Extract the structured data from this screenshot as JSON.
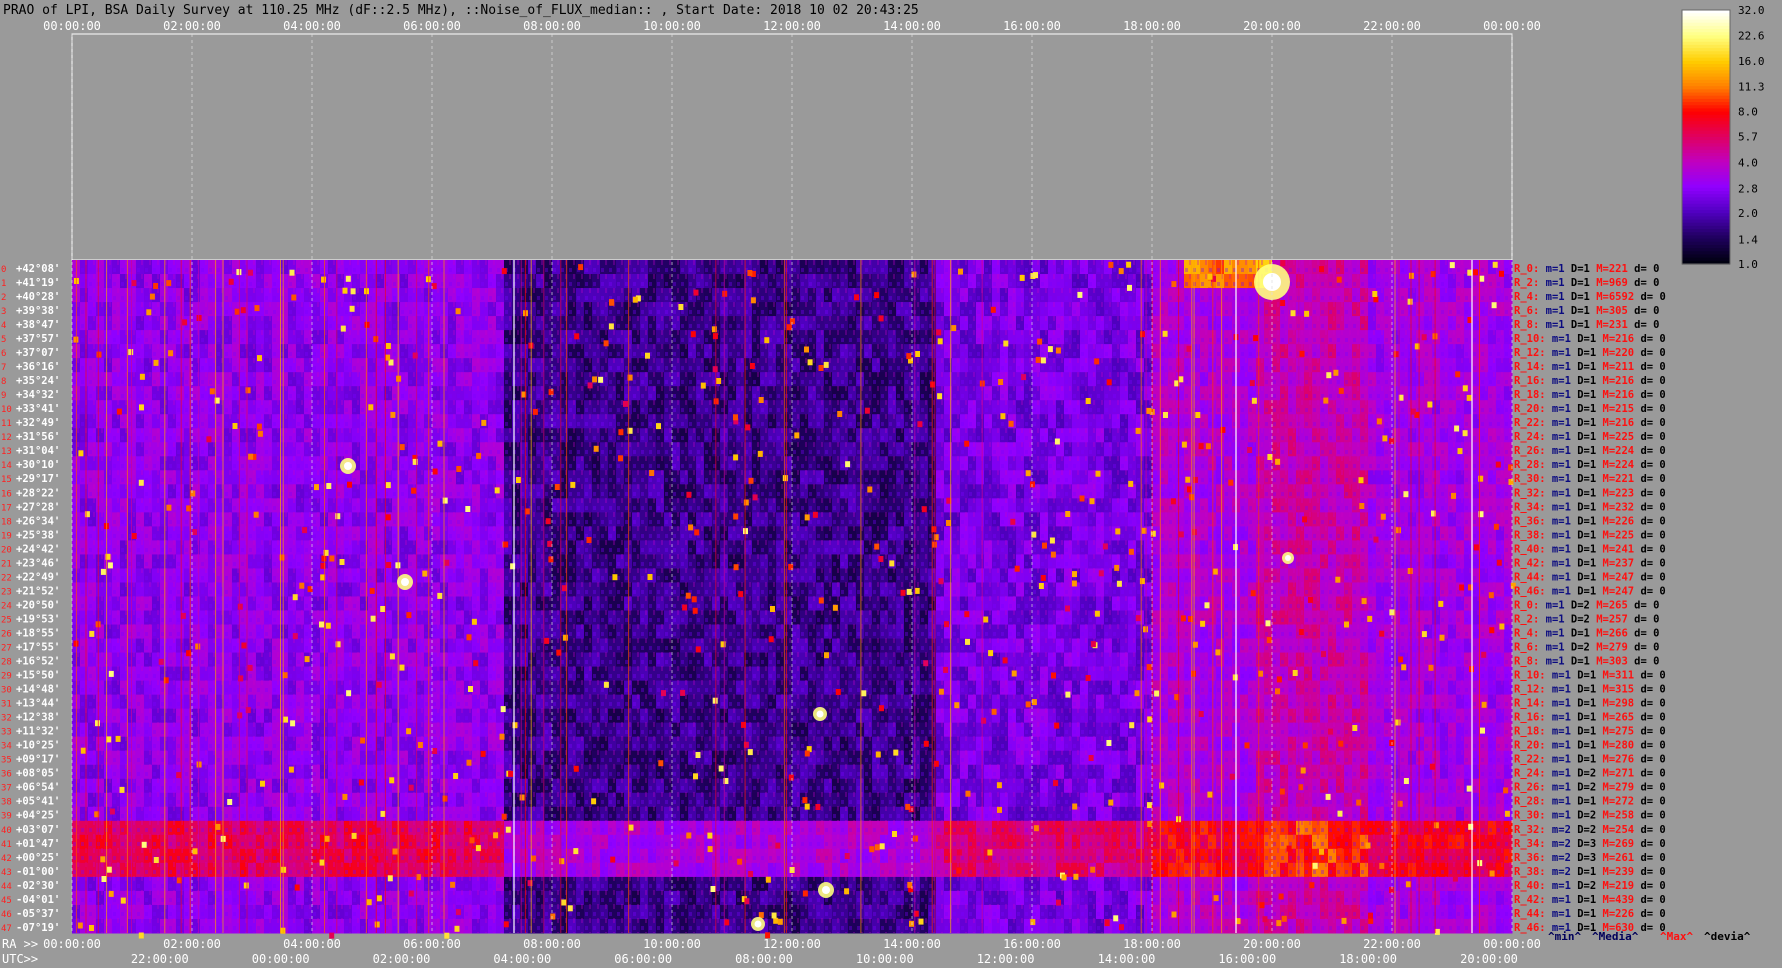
{
  "title": "PRAO of LPI, BSA Daily Survey at 110.25 MHz (dF::2.5 MHz), ::Noise_of_FLUX_median:: , Start Date: 2018 10 02 20:43:25",
  "chart_data": {
    "type": "heatmap",
    "title": "PRAO of LPI, BSA Daily Survey at 110.25 MHz (dF::2.5 MHz), ::Noise_of_FLUX_median:: , Start Date: 2018 10 02 20:43:25",
    "x_top_ticks": [
      "00:00:00",
      "02:00:00",
      "04:00:00",
      "06:00:00",
      "08:00:00",
      "10:00:00",
      "12:00:00",
      "14:00:00",
      "16:00:00",
      "18:00:00",
      "20:00:00",
      "22:00:00",
      "00:00:00"
    ],
    "x_ra_label": "RA >>",
    "x_ra_ticks": [
      "00:00:00",
      "02:00:00",
      "04:00:00",
      "06:00:00",
      "08:00:00",
      "10:00:00",
      "12:00:00",
      "14:00:00",
      "16:00:00",
      "18:00:00",
      "20:00:00",
      "22:00:00",
      "00:00:00"
    ],
    "x_utc_label": "UTC>>",
    "x_utc_ticks": [
      "22:00:00",
      "00:00:00",
      "02:00:00",
      "04:00:00",
      "06:00:00",
      "08:00:00",
      "10:00:00",
      "12:00:00",
      "14:00:00",
      "16:00:00",
      "18:00:00",
      "20:00:00"
    ],
    "y_ticks": [
      "+42°08'",
      "+41°19'",
      "+40°28'",
      "+39°38'",
      "+38°47'",
      "+37°57'",
      "+37°07'",
      "+36°16'",
      "+35°24'",
      "+34°32'",
      "+33°41'",
      "+32°49'",
      "+31°56'",
      "+31°04'",
      "+30°10'",
      "+29°17'",
      "+28°22'",
      "+27°28'",
      "+26°34'",
      "+25°38'",
      "+24°42'",
      "+23°46'",
      "+22°49'",
      "+21°52'",
      "+20°50'",
      "+19°53'",
      "+18°55'",
      "+17°55'",
      "+16°52'",
      "+15°50'",
      "+14°48'",
      "+13°44'",
      "+12°38'",
      "+11°32'",
      "+10°25'",
      "+09°17'",
      "+08°05'",
      "+06°54'",
      "+05°41'",
      "+04°25'",
      "+03°07'",
      "+01°47'",
      "+00°25'",
      "-01°00'",
      "-02°30'",
      "-04°01'",
      "-05°37'",
      "-07°19'"
    ],
    "colorbar": {
      "ticks": [
        "32.0",
        "22.6",
        "16.0",
        "11.3",
        "8.0",
        "5.7",
        "4.0",
        "2.8",
        "2.0",
        "1.4",
        "1.0"
      ],
      "values": [
        32.0,
        22.6,
        16.0,
        11.3,
        8.0,
        5.7,
        4.0,
        2.8,
        2.0,
        1.4,
        1.0
      ],
      "scale": "log",
      "colors": [
        "#ffffff",
        "#ffff80",
        "#ffcc00",
        "#ff8000",
        "#ff0000",
        "#e00060",
        "#c000c0",
        "#9000ff",
        "#5000c0",
        "#200060",
        "#000010"
      ]
    },
    "rows": [
      {
        "r": "R_0:",
        "m": "m=1",
        "d": "D=1",
        "mx": "M=221",
        "dev": "d= 0"
      },
      {
        "r": "R_2:",
        "m": "m=1",
        "d": "D=1",
        "mx": "M=969",
        "dev": "d= 0"
      },
      {
        "r": "R_4:",
        "m": "m=1",
        "d": "D=1",
        "mx": "M=6592",
        "dev": "d= 0"
      },
      {
        "r": "R_6:",
        "m": "m=1",
        "d": "D=1",
        "mx": "M=305",
        "dev": "d= 0"
      },
      {
        "r": "R_8:",
        "m": "m=1",
        "d": "D=1",
        "mx": "M=231",
        "dev": "d= 0"
      },
      {
        "r": "R_10:",
        "m": "m=1",
        "d": "D=1",
        "mx": "M=216",
        "dev": "d= 0"
      },
      {
        "r": "R_12:",
        "m": "m=1",
        "d": "D=1",
        "mx": "M=220",
        "dev": "d= 0"
      },
      {
        "r": "R_14:",
        "m": "m=1",
        "d": "D=1",
        "mx": "M=211",
        "dev": "d= 0"
      },
      {
        "r": "R_16:",
        "m": "m=1",
        "d": "D=1",
        "mx": "M=216",
        "dev": "d= 0"
      },
      {
        "r": "R_18:",
        "m": "m=1",
        "d": "D=1",
        "mx": "M=216",
        "dev": "d= 0"
      },
      {
        "r": "R_20:",
        "m": "m=1",
        "d": "D=1",
        "mx": "M=215",
        "dev": "d= 0"
      },
      {
        "r": "R_22:",
        "m": "m=1",
        "d": "D=1",
        "mx": "M=216",
        "dev": "d= 0"
      },
      {
        "r": "R_24:",
        "m": "m=1",
        "d": "D=1",
        "mx": "M=225",
        "dev": "d= 0"
      },
      {
        "r": "R_26:",
        "m": "m=1",
        "d": "D=1",
        "mx": "M=224",
        "dev": "d= 0"
      },
      {
        "r": "R_28:",
        "m": "m=1",
        "d": "D=1",
        "mx": "M=224",
        "dev": "d= 0"
      },
      {
        "r": "R_30:",
        "m": "m=1",
        "d": "D=1",
        "mx": "M=221",
        "dev": "d= 0"
      },
      {
        "r": "R_32:",
        "m": "m=1",
        "d": "D=1",
        "mx": "M=223",
        "dev": "d= 0"
      },
      {
        "r": "R_34:",
        "m": "m=1",
        "d": "D=1",
        "mx": "M=232",
        "dev": "d= 0"
      },
      {
        "r": "R_36:",
        "m": "m=1",
        "d": "D=1",
        "mx": "M=226",
        "dev": "d= 0"
      },
      {
        "r": "R_38:",
        "m": "m=1",
        "d": "D=1",
        "mx": "M=225",
        "dev": "d= 0"
      },
      {
        "r": "R_40:",
        "m": "m=1",
        "d": "D=1",
        "mx": "M=241",
        "dev": "d= 0"
      },
      {
        "r": "R_42:",
        "m": "m=1",
        "d": "D=1",
        "mx": "M=237",
        "dev": "d= 0"
      },
      {
        "r": "R_44:",
        "m": "m=1",
        "d": "D=1",
        "mx": "M=247",
        "dev": "d= 0"
      },
      {
        "r": "R_46:",
        "m": "m=1",
        "d": "D=1",
        "mx": "M=247",
        "dev": "d= 0"
      },
      {
        "r": "R_0:",
        "m": "m=1",
        "d": "D=2",
        "mx": "M=265",
        "dev": "d= 0"
      },
      {
        "r": "R_2:",
        "m": "m=1",
        "d": "D=2",
        "mx": "M=257",
        "dev": "d= 0"
      },
      {
        "r": "R_4:",
        "m": "m=1",
        "d": "D=1",
        "mx": "M=266",
        "dev": "d= 0"
      },
      {
        "r": "R_6:",
        "m": "m=1",
        "d": "D=2",
        "mx": "M=279",
        "dev": "d= 0"
      },
      {
        "r": "R_8:",
        "m": "m=1",
        "d": "D=1",
        "mx": "M=303",
        "dev": "d= 0"
      },
      {
        "r": "R_10:",
        "m": "m=1",
        "d": "D=1",
        "mx": "M=311",
        "dev": "d= 0"
      },
      {
        "r": "R_12:",
        "m": "m=1",
        "d": "D=1",
        "mx": "M=315",
        "dev": "d= 0"
      },
      {
        "r": "R_14:",
        "m": "m=1",
        "d": "D=1",
        "mx": "M=298",
        "dev": "d= 0"
      },
      {
        "r": "R_16:",
        "m": "m=1",
        "d": "D=1",
        "mx": "M=265",
        "dev": "d= 0"
      },
      {
        "r": "R_18:",
        "m": "m=1",
        "d": "D=1",
        "mx": "M=275",
        "dev": "d= 0"
      },
      {
        "r": "R_20:",
        "m": "m=1",
        "d": "D=1",
        "mx": "M=280",
        "dev": "d= 0"
      },
      {
        "r": "R_22:",
        "m": "m=1",
        "d": "D=1",
        "mx": "M=276",
        "dev": "d= 0"
      },
      {
        "r": "R_24:",
        "m": "m=1",
        "d": "D=2",
        "mx": "M=271",
        "dev": "d= 0"
      },
      {
        "r": "R_26:",
        "m": "m=1",
        "d": "D=2",
        "mx": "M=279",
        "dev": "d= 0"
      },
      {
        "r": "R_28:",
        "m": "m=1",
        "d": "D=1",
        "mx": "M=272",
        "dev": "d= 0"
      },
      {
        "r": "R_30:",
        "m": "m=1",
        "d": "D=2",
        "mx": "M=258",
        "dev": "d= 0"
      },
      {
        "r": "R_32:",
        "m": "m=2",
        "d": "D=2",
        "mx": "M=254",
        "dev": "d= 0"
      },
      {
        "r": "R_34:",
        "m": "m=2",
        "d": "D=3",
        "mx": "M=269",
        "dev": "d= 0"
      },
      {
        "r": "R_36:",
        "m": "m=2",
        "d": "D=3",
        "mx": "M=261",
        "dev": "d= 0"
      },
      {
        "r": "R_38:",
        "m": "m=2",
        "d": "D=1",
        "mx": "M=239",
        "dev": "d= 0"
      },
      {
        "r": "R_40:",
        "m": "m=1",
        "d": "D=2",
        "mx": "M=219",
        "dev": "d= 0"
      },
      {
        "r": "R_42:",
        "m": "m=1",
        "d": "D=1",
        "mx": "M=439",
        "dev": "d= 0"
      },
      {
        "r": "R_44:",
        "m": "m=1",
        "d": "D=1",
        "mx": "M=226",
        "dev": "d= 0"
      },
      {
        "r": "R_46:",
        "m": "m=1",
        "d": "D=1",
        "mx": "M=630",
        "dev": "d= 0"
      }
    ],
    "footer_labels": [
      "^min^",
      "^Media^",
      "^Max^",
      "^devia^"
    ],
    "footer_colors": [
      "#00005a",
      "#00005a",
      "#ff1010",
      "#000000"
    ],
    "row_label_colors": {
      "r": "#ff1010",
      "m": "#0a0a80",
      "d": "#000000",
      "mx": "#ff1010",
      "dev": "#000000"
    },
    "row_index_color": "#ff2020"
  }
}
